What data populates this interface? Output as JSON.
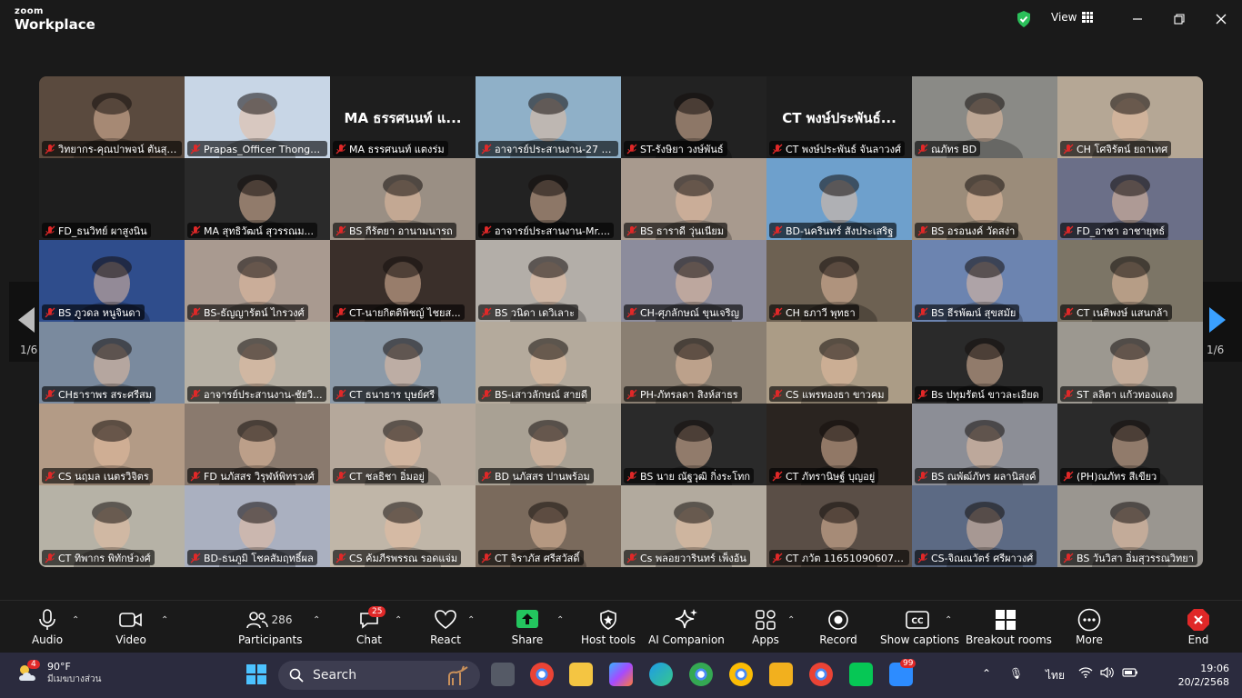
{
  "app": {
    "brand_small": "zoom",
    "brand_large": "Workplace",
    "view_label": "View"
  },
  "gallery": {
    "page_left": "1/6",
    "page_right": "1/6",
    "tiles": [
      {
        "name": "วิทยากร-คุณปาพจน์ ตันสุวร...",
        "bg": "#5a4a3e",
        "face": true
      },
      {
        "name": "Prapas_Officer Thongrak",
        "bg": "#c8d6e6",
        "face": true
      },
      {
        "name": "MA ธรรศนนท์ แตงร่ม",
        "bg": "#1e1e1e",
        "big": "MA ธรรศนนท์ แ...",
        "active": true
      },
      {
        "name": "อาจารย์ประสานงาน-27 โอม ...",
        "bg": "#8fb0c8",
        "face": true
      },
      {
        "name": "ST-รังษิยา วงษ์พันธ์",
        "bg": "#222222",
        "face": true
      },
      {
        "name": "CT พงษ์ประพันธ์ จันลาวงศ์",
        "bg": "#1e1e1e",
        "big": "CT พงษ์ประพันธ์..."
      },
      {
        "name": "ณภัทร BD",
        "bg": "#8a8a86",
        "face": true
      },
      {
        "name": "CH โศจิรัตน์ ยถาเทศ",
        "bg": "#b5a795",
        "face": true
      },
      {
        "name": "FD_ธนวิทย์ ผาสูงนิน",
        "bg": "#1e1e1e"
      },
      {
        "name": "MA สุทธิวัฒน์ สุวรรณม...",
        "bg": "#2a2a2a",
        "face": true
      },
      {
        "name": "BS กีรัตยา อานามนารถ",
        "bg": "#9a8f84",
        "face": true
      },
      {
        "name": "อาจารย์ประสานงาน-Mr....",
        "bg": "#222222",
        "face": true
      },
      {
        "name": "BS ธาราดี วุ่นเนียม",
        "bg": "#a89a8e",
        "face": true
      },
      {
        "name": "BD-นครินทร์ สังประเสริฐ",
        "bg": "#6ea0cc",
        "face": true
      },
      {
        "name": "BS อรอนงค์ วัดสง่า",
        "bg": "#9b8c7a",
        "face": true
      },
      {
        "name": "FD_อาชา อาชายุทธ์",
        "bg": "#6b6f88",
        "face": true
      },
      {
        "name": "BS ภูวดล หนูจินดา",
        "bg": "#2f4d8c",
        "face": true
      },
      {
        "name": "BS-ธัญญารัตน์ ไกรวงศ์",
        "bg": "#a99a90",
        "face": true
      },
      {
        "name": "CT-นายกิตติพิชญ์ ไชยส...",
        "bg": "#3a2f2a",
        "face": true
      },
      {
        "name": "BS วนิดา เดวิเลาะ",
        "bg": "#b3aea8",
        "face": true
      },
      {
        "name": "CH-ศุภลักษณ์ ขุนเจริญ",
        "bg": "#8c8c9c",
        "face": true
      },
      {
        "name": "CH ธภาวี พุทธา",
        "bg": "#6d6152",
        "face": true
      },
      {
        "name": "BS ธีรพัฒน์ สุขสมัย",
        "bg": "#6c84b0",
        "face": true
      },
      {
        "name": "CT เนติพงษ์ แสนกล้า",
        "bg": "#7c7566",
        "face": true
      },
      {
        "name": "CHธาราพร สระศรีสม",
        "bg": "#7a8a9e",
        "face": true
      },
      {
        "name": "อาจารย์ประสานงาน-ชัยวิ...",
        "bg": "#b6b0a4",
        "face": true
      },
      {
        "name": "CT ธนาธาร บุษย์ศรี",
        "bg": "#8c9aa8",
        "face": true
      },
      {
        "name": "BS-เสาวลักษณ์ สายดี",
        "bg": "#b4aa9c",
        "face": true
      },
      {
        "name": "PH-ภัทรลดา สิงห์สาธร",
        "bg": "#8a7f72",
        "face": true
      },
      {
        "name": "CS แพรทองธา ขาวคม",
        "bg": "#ab9c86",
        "face": true
      },
      {
        "name": "Bs ปทุมรัตน์ ขาวละเอียด",
        "bg": "#2a2a2a",
        "face": true
      },
      {
        "name": "ST ลลิตา แก้วทองแดง",
        "bg": "#9c9890",
        "face": true
      },
      {
        "name": "CS นฤมล เนตรวิจิตร",
        "bg": "#b39b86",
        "face": true
      },
      {
        "name": "FD นภัสสร วิรุฬห์พิทรวงศ์",
        "bg": "#8a7a6e",
        "face": true
      },
      {
        "name": "CT ชลธิชา อิ่มอยู่",
        "bg": "#b5a89b",
        "face": true
      },
      {
        "name": "BD นภัสสร ปานพร้อม",
        "bg": "#a9a194",
        "face": true
      },
      {
        "name": "BS นาย ณัฐวุฒิ กิ่งระโทก",
        "bg": "#2a2a2a",
        "face": true
      },
      {
        "name": "CT ภัทรานิษฐ์ บุญอยู่",
        "bg": "#2a2420",
        "face": true
      },
      {
        "name": "BS ณพัฒ์ภัทร ผลานิสงค์",
        "bg": "#8c8e96",
        "face": true
      },
      {
        "name": "(PH)ณภัทร สีเขียว",
        "bg": "#2a2a2a",
        "face": true
      },
      {
        "name": "CT ทิพากร พิทักษ์วงศ์",
        "bg": "#b6b2a6",
        "face": true
      },
      {
        "name": "BD-ธนภูมิ โชคสัมฤทธิ์ผล",
        "bg": "#aab0c0",
        "face": true
      },
      {
        "name": "CS ค้มภีรพรรณ รอดแจ่ม",
        "bg": "#c0b6a8",
        "face": true
      },
      {
        "name": "CT จิราภัส ศรีสวัสดิ์",
        "bg": "#7a6a5c",
        "face": true
      },
      {
        "name": "Cs พลอยวารินทร์ เพ็งอ้น",
        "bg": "#b2aa9e",
        "face": true
      },
      {
        "name": "CT ภวัต 1165109060780",
        "bg": "#5a4e46",
        "face": true
      },
      {
        "name": "CS-จิณณวัตร์ ศรีผาวงศ์",
        "bg": "#5c6a84",
        "face": true
      },
      {
        "name": "BS วันวิสา อิ่มสุวรรณวิทยา",
        "bg": "#9a9690",
        "face": true
      }
    ]
  },
  "toolbar": {
    "audio": "Audio",
    "video": "Video",
    "participants": "Participants",
    "participants_count": "286",
    "chat": "Chat",
    "chat_badge": "25",
    "react": "React",
    "share": "Share",
    "host_tools": "Host tools",
    "ai_companion": "AI Companion",
    "apps": "Apps",
    "record": "Record",
    "show_captions": "Show captions",
    "breakout_rooms": "Breakout rooms",
    "more": "More",
    "end": "End"
  },
  "taskbar": {
    "weather_badge": "4",
    "temperature": "90°F",
    "weather_desc": "มีเมฆบางส่วน",
    "search_placeholder": "Search",
    "zoom_badge": "99",
    "language": "ไทย",
    "time": "19:06",
    "date": "20/2/2568"
  },
  "colors": {
    "active_border": "#2bd36b",
    "share_green": "#23c55e",
    "end_red": "#e02828",
    "nav_blue": "#3aa0ff"
  }
}
